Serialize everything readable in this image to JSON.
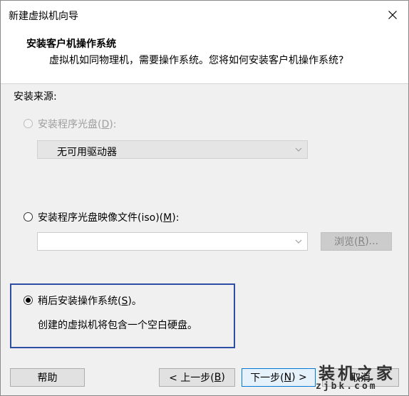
{
  "window": {
    "title": "新建虚拟机向导"
  },
  "header": {
    "title": "安装客户机操作系统",
    "subtitle": "虚拟机如同物理机，需要操作系统。您将如何安装客户机操作系统?"
  },
  "install_source": {
    "label": "安装来源:",
    "options": [
      {
        "label_prefix": "安装程序光盘(",
        "mnemonic": "D",
        "label_suffix": "):",
        "enabled": false,
        "selected": false
      },
      {
        "label_prefix": "安装程序光盘映像文件(iso)(",
        "mnemonic": "M",
        "label_suffix": "):",
        "enabled": true,
        "selected": false
      },
      {
        "label_prefix": "稍后安装操作系统(",
        "mnemonic": "S",
        "label_suffix": ")。",
        "enabled": true,
        "selected": true
      }
    ],
    "drive_select_value": "无可用驱动器",
    "iso_path_value": "",
    "browse_prefix": "浏览(",
    "browse_mnemonic": "R",
    "browse_suffix": ")...",
    "later_description": "创建的虚拟机将包含一个空白硬盘。"
  },
  "footer": {
    "help": "帮助",
    "back_prefix": "< 上一步(",
    "back_mnemonic": "B",
    "back_suffix": ")",
    "next_prefix": "下一步(",
    "next_mnemonic": "N",
    "next_suffix": ") >",
    "cancel": "取消"
  },
  "watermark": {
    "text_big": "装机之家",
    "text_small": "zjbk.com"
  },
  "colors": {
    "highlight_border": "#2e4ea6",
    "primary_border": "#0078d7"
  }
}
